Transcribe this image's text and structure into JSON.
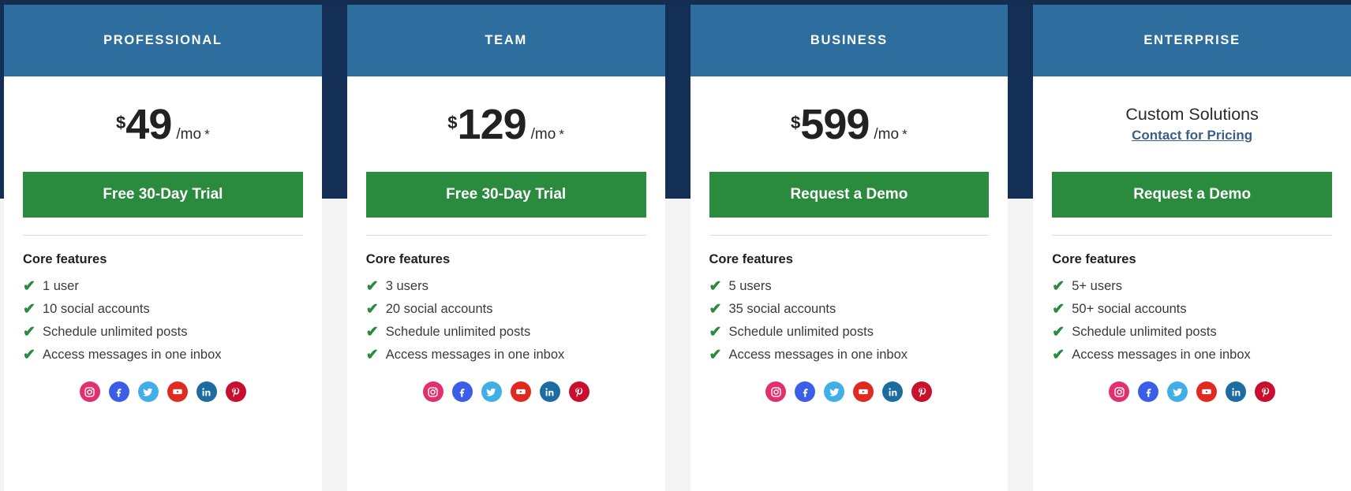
{
  "theme": {
    "page_background": "#f4f4f4",
    "navy_field": "#132f55",
    "header_blue": "#2d6e9e",
    "cta_green": "#2a8a3e",
    "check_green": "#2a8a3e",
    "link_blue": "#3b5e88",
    "card_white": "#ffffff"
  },
  "common": {
    "features_heading": "Core features",
    "currency_symbol": "$",
    "per_unit": "/mo",
    "asterisk": "*",
    "check_icon": "check-icon"
  },
  "social_icons": [
    {
      "name": "instagram-icon",
      "label": "Instagram",
      "color": "#e1306c"
    },
    {
      "name": "facebook-icon",
      "label": "Facebook",
      "color": "#3b5ee8"
    },
    {
      "name": "twitter-icon",
      "label": "Twitter",
      "color": "#42aee8"
    },
    {
      "name": "youtube-icon",
      "label": "YouTube",
      "color": "#e02a20"
    },
    {
      "name": "linkedin-icon",
      "label": "LinkedIn",
      "color": "#1c6ca1"
    },
    {
      "name": "pinterest-icon",
      "label": "Pinterest",
      "color": "#c8102e"
    }
  ],
  "plans": [
    {
      "id": "professional",
      "title": "PROFESSIONAL",
      "price_type": "amount",
      "currency": "$",
      "amount": "49",
      "per_unit": "/mo",
      "asterisk": "*",
      "cta_label": "Free 30-Day Trial",
      "features_heading": "Core features",
      "features": [
        "1 user",
        "10 social accounts",
        "Schedule unlimited posts",
        "Access messages in one inbox"
      ]
    },
    {
      "id": "team",
      "title": "TEAM",
      "price_type": "amount",
      "currency": "$",
      "amount": "129",
      "per_unit": "/mo",
      "asterisk": "*",
      "cta_label": "Free 30-Day Trial",
      "features_heading": "Core features",
      "features": [
        "3 users",
        "20 social accounts",
        "Schedule unlimited posts",
        "Access messages in one inbox"
      ]
    },
    {
      "id": "business",
      "title": "BUSINESS",
      "price_type": "amount",
      "currency": "$",
      "amount": "599",
      "per_unit": "/mo",
      "asterisk": "*",
      "cta_label": "Request a Demo",
      "features_heading": "Core features",
      "features": [
        "5 users",
        "35 social accounts",
        "Schedule unlimited posts",
        "Access messages in one inbox"
      ]
    },
    {
      "id": "enterprise",
      "title": "ENTERPRISE",
      "price_type": "custom",
      "custom_headline": "Custom Solutions",
      "custom_link": "Contact for Pricing",
      "cta_label": "Request a Demo",
      "features_heading": "Core features",
      "features": [
        "5+ users",
        "50+ social accounts",
        "Schedule unlimited posts",
        "Access messages in one inbox"
      ]
    }
  ]
}
